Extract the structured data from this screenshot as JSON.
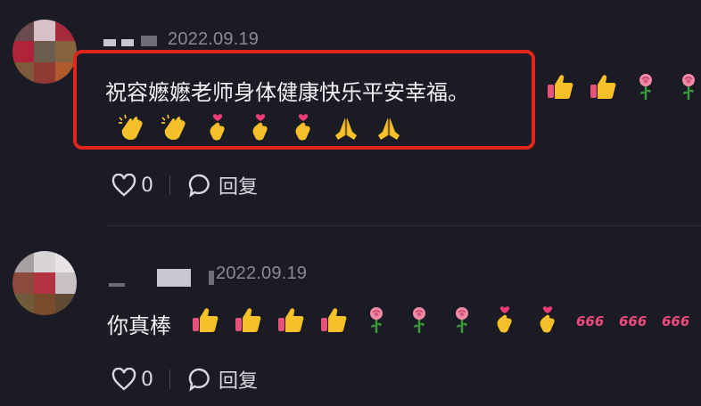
{
  "comments": [
    {
      "date": "2022.09.19",
      "text": "祝容嬷嬷老师身体健康快乐平安幸福。",
      "inline_emojis": [
        "thumbs-up",
        "thumbs-up",
        "rose",
        "rose"
      ],
      "emojis_line2": [
        "clapping-hands",
        "clapping-hands",
        "hand-heart",
        "hand-heart",
        "hand-heart",
        "folded-hands",
        "folded-hands"
      ],
      "likes": "0",
      "reply_label": "回复"
    },
    {
      "date": "2022.09.19",
      "text": "你真棒",
      "inline_emojis": [
        "thumbs-up",
        "thumbs-up",
        "thumbs-up",
        "thumbs-up",
        "rose",
        "rose",
        "rose",
        "hand-heart",
        "hand-heart",
        "666",
        "666",
        "666"
      ],
      "likes": "0",
      "reply_label": "回复"
    }
  ],
  "colors": {
    "background": "#1b1b25",
    "highlight_border": "#e0251b",
    "date_text": "#8a8a96",
    "emoji_666": "#ef4a7d"
  }
}
